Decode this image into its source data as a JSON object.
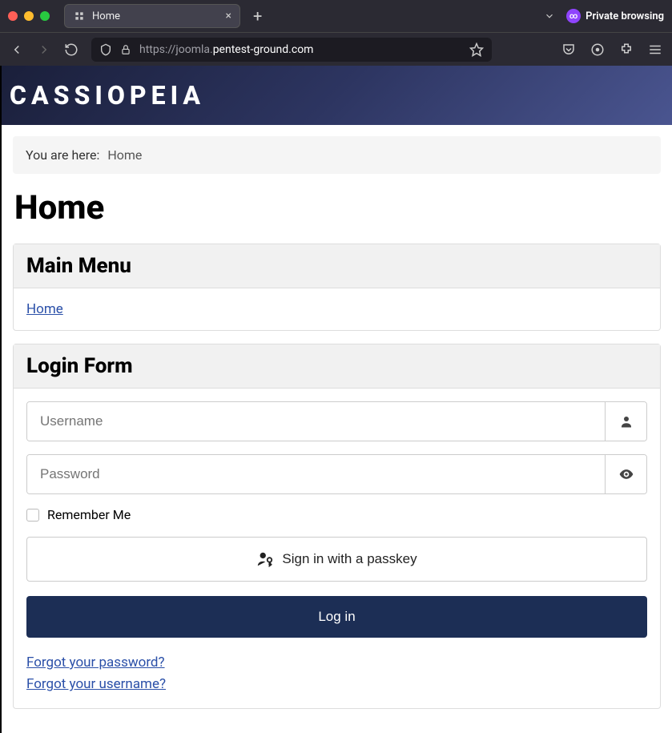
{
  "browser": {
    "tab_title": "Home",
    "private_label": "Private browsing",
    "url_prefix": "https://joomla.",
    "url_domain": "pentest-ground.com"
  },
  "site": {
    "logo_text": "CASSIOPEIA"
  },
  "breadcrumb": {
    "label": "You are here:",
    "current": "Home"
  },
  "page": {
    "title": "Home"
  },
  "main_menu": {
    "heading": "Main Menu",
    "items": [
      "Home"
    ]
  },
  "login_form": {
    "heading": "Login Form",
    "username_placeholder": "Username",
    "password_placeholder": "Password",
    "remember_label": "Remember Me",
    "passkey_label": "Sign in with a passkey",
    "login_label": "Log in",
    "forgot_password": "Forgot your password?",
    "forgot_username": "Forgot your username?"
  }
}
